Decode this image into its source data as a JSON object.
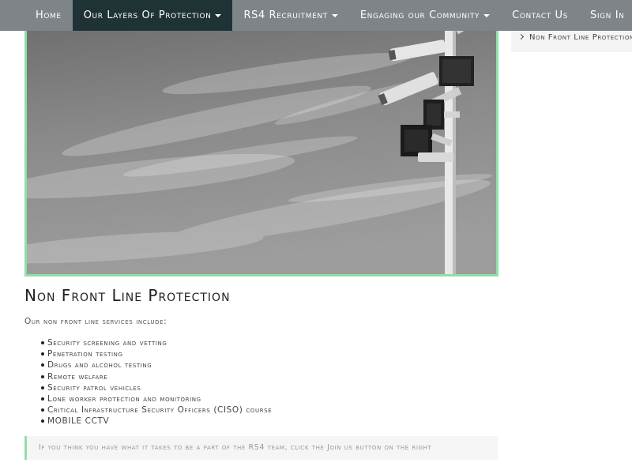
{
  "nav": {
    "items": [
      {
        "label": "Home",
        "dropdown": false,
        "active": false
      },
      {
        "label": "Our Layers Of Protection",
        "dropdown": true,
        "active": true
      },
      {
        "label": "RS4 Recruitment",
        "dropdown": true,
        "active": false
      },
      {
        "label": "Engaging our Community",
        "dropdown": true,
        "active": false
      },
      {
        "label": "Contact Us",
        "dropdown": false,
        "active": false
      },
      {
        "label": "Sign In",
        "dropdown": false,
        "active": false
      }
    ]
  },
  "sidebar": {
    "items": [
      {
        "label": "Non Front Line Protection"
      }
    ]
  },
  "hero": {
    "icon": "cctv-cameras-photo"
  },
  "main": {
    "title": "Non Front Line Protection",
    "intro": "Our non front line services include:",
    "services": [
      "Security screening and vetting",
      "Penetration testing",
      "Drugs and alcohol testing",
      "Remote welfare",
      "Security patrol vehicles",
      "Lone worker protection and monitoring",
      "Critical Infrastructure Security Officers (CISO) course",
      "MOBILE CCTV"
    ],
    "callout": "If you think you have what it takes to be a part of the RS4 team, click the Join us button on the right"
  },
  "colors": {
    "nav_bg": "#7e8487",
    "nav_active": "#1f3336",
    "accent": "#8fe0a8"
  }
}
